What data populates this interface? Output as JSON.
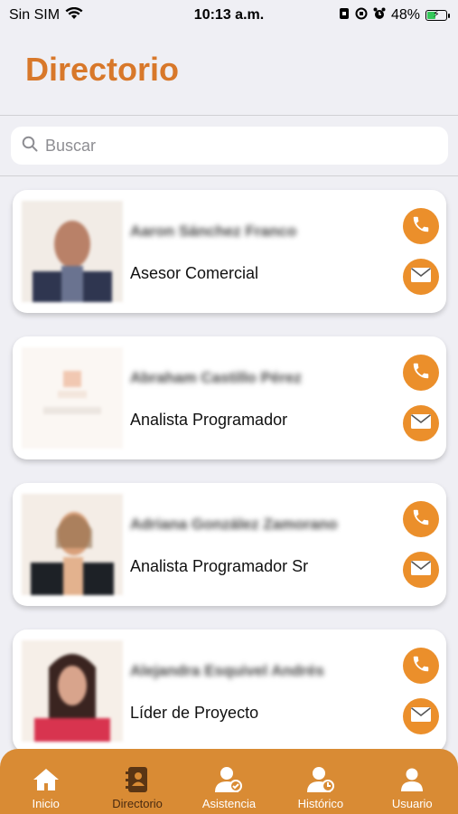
{
  "status_bar": {
    "carrier": "Sin SIM",
    "time": "10:13 a.m.",
    "battery": "48%",
    "battery_level": 0.48
  },
  "header": {
    "title": "Directorio"
  },
  "search": {
    "placeholder": "Buscar",
    "value": ""
  },
  "contacts": [
    {
      "name": "Aaron Sánchez Franco",
      "role": "Asesor Comercial"
    },
    {
      "name": "Abraham Castillo Pérez",
      "role": "Analista Programador"
    },
    {
      "name": "Adriana González Zamorano",
      "role": "Analista Programador Sr"
    },
    {
      "name": "Alejandra Esquivel Andrés",
      "role": "Líder de Proyecto"
    }
  ],
  "tabbar": {
    "items": [
      {
        "label": "Inicio",
        "icon": "home-icon"
      },
      {
        "label": "Directorio",
        "icon": "contacts-book-icon",
        "active": true
      },
      {
        "label": "Asistencia",
        "icon": "user-check-icon"
      },
      {
        "label": "Histórico",
        "icon": "user-history-icon"
      },
      {
        "label": "Usuario",
        "icon": "user-icon"
      }
    ]
  },
  "colors": {
    "accent": "#d8782a",
    "button": "#eb8f2b",
    "tabbar": "#d98b34",
    "background": "#efeff4"
  }
}
